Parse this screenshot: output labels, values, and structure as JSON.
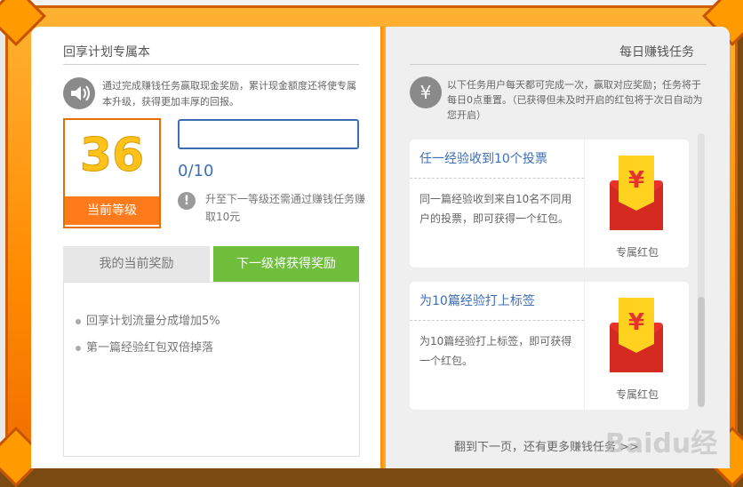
{
  "left_panel": {
    "title": "回享计划专属本",
    "description": "通过完成赚钱任务赢取现金奖励，累计现金额度还将使专属本升级，获得更加丰厚的回报。",
    "level": {
      "number": "36",
      "label": "当前等级"
    },
    "progress": {
      "text": "0/10",
      "fraction": 0.0
    },
    "next_level_note": "升至下一等级还需通过赚钱任务赚取10元",
    "tabs": [
      {
        "label": "我的当前奖励",
        "active": false
      },
      {
        "label": "下一级将获得奖励",
        "active": true
      }
    ],
    "rewards": [
      "回享计划流量分成增加5%",
      "第一篇经验红包双倍掉落"
    ]
  },
  "right_panel": {
    "title": "每日赚钱任务",
    "description": "以下任务用户每天都可完成一次，赢取对应奖励；任务将于每日0点重置。（已获得但未及时开启的红包将于次日自动为您开启）",
    "tasks": [
      {
        "title": "任一经验收到10个投票",
        "description": "同一篇经验收到来自10名不同用户的投票，即可获得一个红包。",
        "reward_label": "专属红包"
      },
      {
        "title": "为10篇经验打上标签",
        "description": "为10篇经验打上标签，即可获得一个红包。",
        "reward_label": "专属红包"
      }
    ],
    "footer": "翻到下一页，还有更多赚钱任务 >>"
  },
  "watermark": "Baidu经验",
  "icons": {
    "speaker": "speaker-icon",
    "info": "info-icon",
    "yen": "yen-icon",
    "envelope": "red-envelope-icon"
  },
  "colors": {
    "frame_orange": "#ff8a00",
    "link_blue": "#3c6eb4",
    "tab_green": "#6fbf3c",
    "level_yellow": "#ffc21a",
    "envelope_red": "#e8332a"
  }
}
